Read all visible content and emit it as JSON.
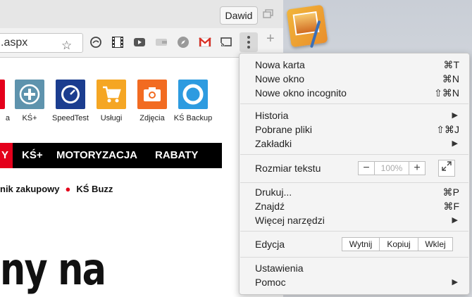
{
  "browser": {
    "profile_name": "Dawid",
    "omnibox_text": ".aspx",
    "new_tab_symbol": "+"
  },
  "page": {
    "apps": [
      {
        "label": "a",
        "color": "#e4001b",
        "icon": "app-icon"
      },
      {
        "label": "KŚ+",
        "color": "#5e93ad",
        "icon": "plus-icon"
      },
      {
        "label": "SpeedTest",
        "color": "#1b3d8f",
        "icon": "speedometer-icon"
      },
      {
        "label": "Usługi",
        "color": "#f5a623",
        "icon": "cart-icon"
      },
      {
        "label": "Zdjęcia",
        "color": "#f26b21",
        "icon": "camera-icon"
      },
      {
        "label": "KŚ Backup",
        "color": "#2d9be0",
        "icon": "lifebuoy-icon"
      }
    ],
    "nav": {
      "first": "Y",
      "items": [
        "KŚ+",
        "MOTORYZACJA",
        "RABATY"
      ]
    },
    "links": [
      "nik zakupowy",
      "KŚ Buzz"
    ],
    "headline": "ny na"
  },
  "menu": {
    "new_tab": {
      "label": "Nowa karta",
      "shortcut": "⌘T"
    },
    "new_window": {
      "label": "Nowe okno",
      "shortcut": "⌘N"
    },
    "incognito": {
      "label": "Nowe okno incognito",
      "shortcut": "⇧⌘N"
    },
    "history": {
      "label": "Historia"
    },
    "downloads": {
      "label": "Pobrane pliki",
      "shortcut": "⇧⌘J"
    },
    "bookmarks": {
      "label": "Zakładki"
    },
    "zoom": {
      "label": "Rozmiar tekstu",
      "minus": "−",
      "value": "100%",
      "plus": "+"
    },
    "print": {
      "label": "Drukuj...",
      "shortcut": "⌘P"
    },
    "find": {
      "label": "Znajdź",
      "shortcut": "⌘F"
    },
    "more_tools": {
      "label": "Więcej narzędzi"
    },
    "edit": {
      "label": "Edycja",
      "cut": "Wytnij",
      "copy": "Kopiuj",
      "paste": "Wklej"
    },
    "settings": {
      "label": "Ustawienia"
    },
    "help": {
      "label": "Pomoc"
    }
  },
  "colors": {
    "accent_red": "#e4001b",
    "nav_black": "#000000",
    "menu_bg": "#f4f4f4"
  }
}
